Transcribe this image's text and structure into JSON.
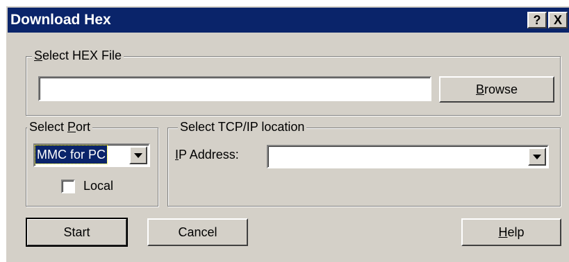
{
  "window": {
    "title": "Download Hex",
    "help_button": "?",
    "close_button": "X"
  },
  "hex_file": {
    "legend_mnemonic": "S",
    "legend_rest": "elect HEX File",
    "path_value": "",
    "browse_mnemonic": "B",
    "browse_rest": "rowse"
  },
  "port": {
    "legend_prefix": "Select ",
    "legend_mnemonic": "P",
    "legend_rest": "ort",
    "selected": "MMC for PC",
    "local_label": "Local",
    "local_checked": false
  },
  "tcpip": {
    "legend": "Select TCP/IP location",
    "ip_label_mnemonic": "I",
    "ip_label_rest": "P Address:",
    "ip_value": ""
  },
  "buttons": {
    "start": "Start",
    "cancel": "Cancel",
    "help_mnemonic": "H",
    "help_rest": "elp"
  }
}
